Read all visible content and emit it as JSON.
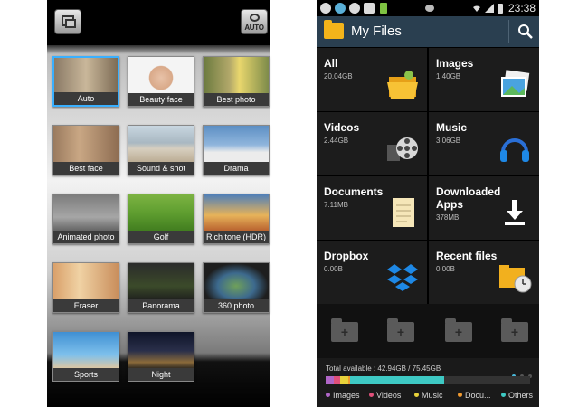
{
  "camera": {
    "auto_badge": "AUTO",
    "modes": [
      {
        "label": "Auto",
        "selected": true
      },
      {
        "label": "Beauty face",
        "selected": false
      },
      {
        "label": "Best photo",
        "selected": false
      },
      {
        "label": "Best face",
        "selected": false
      },
      {
        "label": "Sound & shot",
        "selected": false
      },
      {
        "label": "Drama",
        "selected": false
      },
      {
        "label": "Animated photo",
        "selected": false
      },
      {
        "label": "Golf",
        "selected": false
      },
      {
        "label": "Rich tone (HDR)",
        "selected": false
      },
      {
        "label": "Eraser",
        "selected": false
      },
      {
        "label": "Panorama",
        "selected": false
      },
      {
        "label": "360 photo",
        "selected": false
      },
      {
        "label": "Sports",
        "selected": false
      },
      {
        "label": "Night",
        "selected": false
      }
    ]
  },
  "myfiles": {
    "status_time": "23:38",
    "title": "My Files",
    "categories": [
      {
        "name": "All",
        "size": "20.04GB",
        "icon": "open-folder-icon"
      },
      {
        "name": "Images",
        "size": "1.40GB",
        "icon": "pictures-icon"
      },
      {
        "name": "Videos",
        "size": "2.44GB",
        "icon": "film-reel-icon"
      },
      {
        "name": "Music",
        "size": "3.06GB",
        "icon": "headphones-icon"
      },
      {
        "name": "Documents",
        "size": "7.11MB",
        "icon": "notepad-icon"
      },
      {
        "name": "Downloaded Apps",
        "size": "378MB",
        "icon": "download-icon"
      },
      {
        "name": "Dropbox",
        "size": "0.00B",
        "icon": "dropbox-icon"
      },
      {
        "name": "Recent files",
        "size": "0.00B",
        "icon": "clock-folder-icon"
      }
    ],
    "storage_text": "Total available : 42.94GB / 75.45GB",
    "storage_segments": [
      {
        "name": "Images",
        "fraction": 0.04,
        "color": "#b066c8"
      },
      {
        "name": "Videos",
        "fraction": 0.03,
        "color": "#e0507a"
      },
      {
        "name": "Music",
        "fraction": 0.04,
        "color": "#e8d23a"
      },
      {
        "name": "Docu...",
        "fraction": 0.01,
        "color": "#f09a30"
      },
      {
        "name": "Others",
        "fraction": 0.46,
        "color": "#3ec9c4"
      }
    ],
    "legend": [
      "Images",
      "Videos",
      "Music",
      "Docu...",
      "Others"
    ]
  }
}
